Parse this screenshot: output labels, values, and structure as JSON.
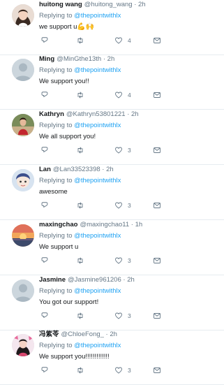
{
  "replying_prefix": "Replying to",
  "tweets": [
    {
      "name": "huitong wang",
      "handle": "@huitong_wang",
      "time": "2h",
      "mention": "@thepointwithlx",
      "text": "we support u",
      "emoji": "💪🙌",
      "retweets": "",
      "likes": "4",
      "avatar": "photo-girl"
    },
    {
      "name": "Ming",
      "handle": "@MinGthe13th",
      "time": "2h",
      "mention": "@thepointwithlx",
      "text": "We support you!!",
      "emoji": "",
      "retweets": "",
      "likes": "4",
      "avatar": "default"
    },
    {
      "name": "Kathryn",
      "handle": "@Kathryn53801221",
      "time": "2h",
      "mention": "@thepointwithlx",
      "text": "We all support you!",
      "emoji": "",
      "retweets": "",
      "likes": "3",
      "avatar": "photo-red"
    },
    {
      "name": "Lan",
      "handle": "@Lan33523398",
      "time": "2h",
      "mention": "@thepointwithlx",
      "text": "awesome",
      "emoji": "",
      "retweets": "",
      "likes": "3",
      "avatar": "cartoon"
    },
    {
      "name": "maxingchao",
      "handle": "@maxingchao11",
      "time": "1h",
      "mention": "@thepointwithlx",
      "text": "We support u",
      "emoji": "",
      "retweets": "",
      "likes": "3",
      "avatar": "sunset"
    },
    {
      "name": "Jasmine",
      "handle": "@Jasmine961206",
      "time": "2h",
      "mention": "@thepointwithlx",
      "text": "You got our support!",
      "emoji": "",
      "retweets": "",
      "likes": "3",
      "avatar": "default"
    },
    {
      "name": "冯紫苓",
      "handle": "@ChloeFong_",
      "time": "2h",
      "mention": "@thepointwithlx",
      "text": "We support you!!!!!!!!!!!!!",
      "emoji": "",
      "retweets": "",
      "likes": "3",
      "avatar": "photo-pink"
    }
  ]
}
